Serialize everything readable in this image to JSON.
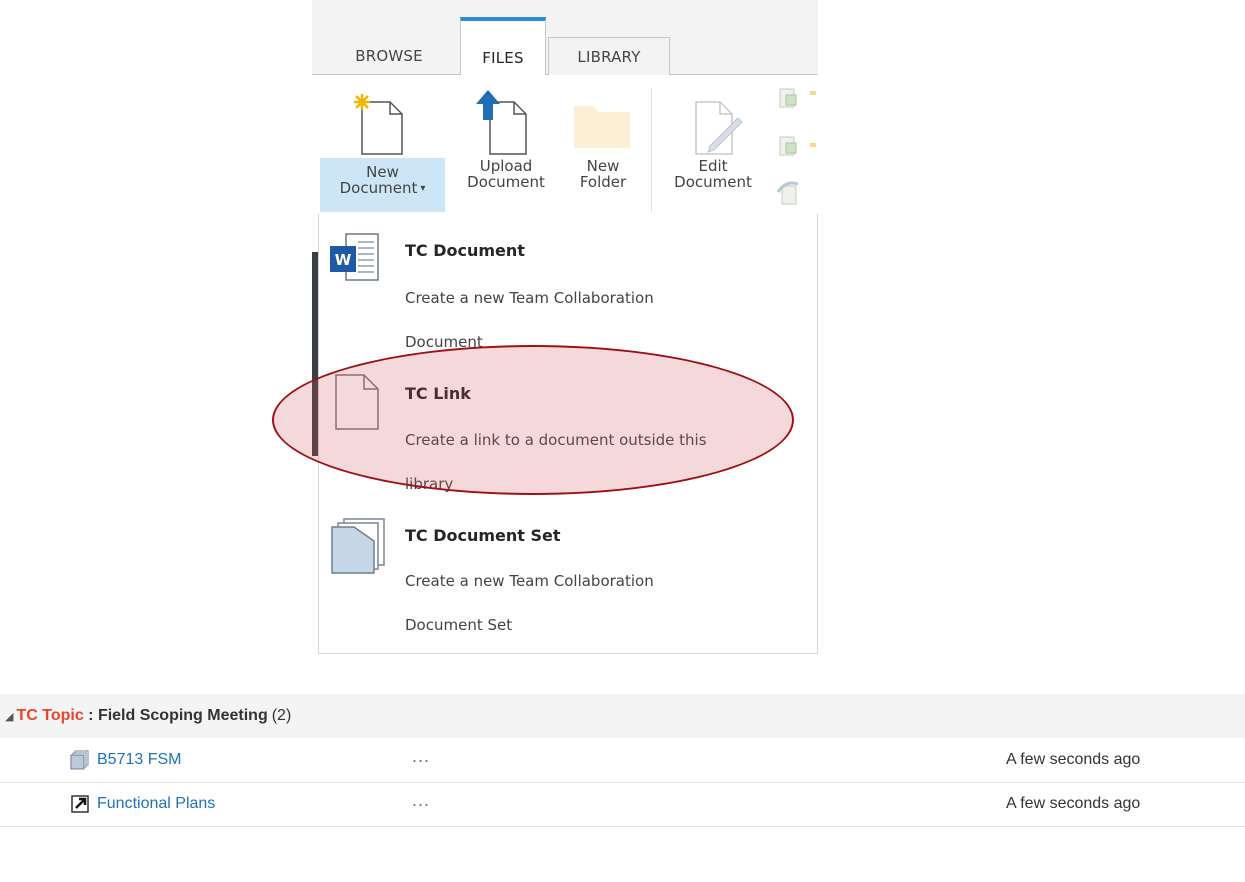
{
  "ribbon": {
    "tabs": [
      {
        "label": "BROWSE",
        "active": false
      },
      {
        "label": "FILES",
        "active": true
      },
      {
        "label": "LIBRARY",
        "active": false
      }
    ],
    "buttons": {
      "new_document": {
        "line1": "New",
        "line2": "Document"
      },
      "upload_document": {
        "line1": "Upload",
        "line2": "Document"
      },
      "new_folder": {
        "line1": "New",
        "line2": "Folder"
      },
      "edit_document": {
        "line1": "Edit",
        "line2": "Document"
      }
    }
  },
  "new_document_menu": {
    "items": [
      {
        "title": "TC Document",
        "description_line1": "Create a new Team Collaboration",
        "description_line2": "Document",
        "icon": "word-document-icon"
      },
      {
        "title": "TC Link",
        "description_line1": "Create a link to a document outside this",
        "description_line2": "library",
        "icon": "blank-page-icon",
        "highlighted": true
      },
      {
        "title": "TC Document Set",
        "description_line1": "Create a new Team Collaboration",
        "description_line2": "Document Set",
        "icon": "document-set-icon"
      }
    ]
  },
  "list": {
    "group": {
      "category": "TC Topic",
      "separator": " : ",
      "name": "Field Scoping Meeting",
      "count": "(2)"
    },
    "rows": [
      {
        "name": "B5713 FSM",
        "menu": "...",
        "modified": "A few seconds ago",
        "icon": "document-set-icon"
      },
      {
        "name": "Functional Plans",
        "menu": "...",
        "modified": "A few seconds ago",
        "icon": "link-icon"
      }
    ]
  },
  "colors": {
    "accent_blue": "#2a8dd4",
    "link_blue": "#1e73be",
    "category_red": "#e8452c",
    "highlight_ring": "#a10f15",
    "selected_button_bg": "#cde6f7"
  }
}
